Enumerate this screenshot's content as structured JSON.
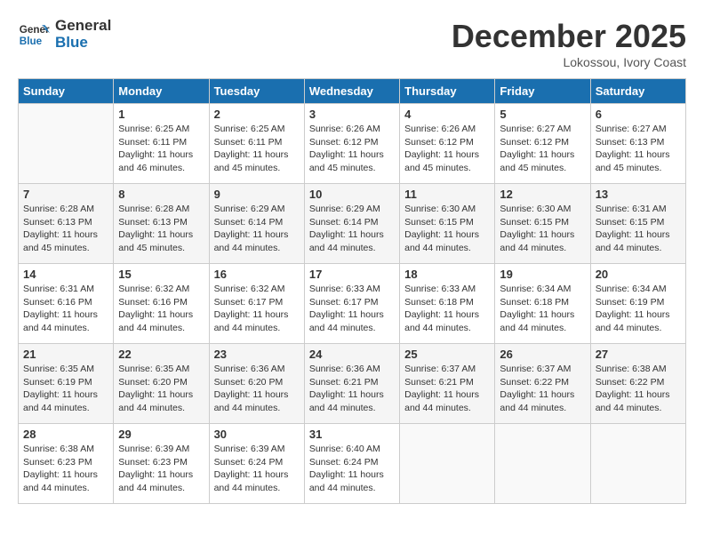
{
  "header": {
    "logo_line1": "General",
    "logo_line2": "Blue",
    "month": "December 2025",
    "location": "Lokossou, Ivory Coast"
  },
  "days_of_week": [
    "Sunday",
    "Monday",
    "Tuesday",
    "Wednesday",
    "Thursday",
    "Friday",
    "Saturday"
  ],
  "weeks": [
    [
      {
        "day": "",
        "info": ""
      },
      {
        "day": "1",
        "info": "Sunrise: 6:25 AM\nSunset: 6:11 PM\nDaylight: 11 hours\nand 46 minutes."
      },
      {
        "day": "2",
        "info": "Sunrise: 6:25 AM\nSunset: 6:11 PM\nDaylight: 11 hours\nand 45 minutes."
      },
      {
        "day": "3",
        "info": "Sunrise: 6:26 AM\nSunset: 6:12 PM\nDaylight: 11 hours\nand 45 minutes."
      },
      {
        "day": "4",
        "info": "Sunrise: 6:26 AM\nSunset: 6:12 PM\nDaylight: 11 hours\nand 45 minutes."
      },
      {
        "day": "5",
        "info": "Sunrise: 6:27 AM\nSunset: 6:12 PM\nDaylight: 11 hours\nand 45 minutes."
      },
      {
        "day": "6",
        "info": "Sunrise: 6:27 AM\nSunset: 6:13 PM\nDaylight: 11 hours\nand 45 minutes."
      }
    ],
    [
      {
        "day": "7",
        "info": "Sunrise: 6:28 AM\nSunset: 6:13 PM\nDaylight: 11 hours\nand 45 minutes."
      },
      {
        "day": "8",
        "info": "Sunrise: 6:28 AM\nSunset: 6:13 PM\nDaylight: 11 hours\nand 45 minutes."
      },
      {
        "day": "9",
        "info": "Sunrise: 6:29 AM\nSunset: 6:14 PM\nDaylight: 11 hours\nand 44 minutes."
      },
      {
        "day": "10",
        "info": "Sunrise: 6:29 AM\nSunset: 6:14 PM\nDaylight: 11 hours\nand 44 minutes."
      },
      {
        "day": "11",
        "info": "Sunrise: 6:30 AM\nSunset: 6:15 PM\nDaylight: 11 hours\nand 44 minutes."
      },
      {
        "day": "12",
        "info": "Sunrise: 6:30 AM\nSunset: 6:15 PM\nDaylight: 11 hours\nand 44 minutes."
      },
      {
        "day": "13",
        "info": "Sunrise: 6:31 AM\nSunset: 6:15 PM\nDaylight: 11 hours\nand 44 minutes."
      }
    ],
    [
      {
        "day": "14",
        "info": "Sunrise: 6:31 AM\nSunset: 6:16 PM\nDaylight: 11 hours\nand 44 minutes."
      },
      {
        "day": "15",
        "info": "Sunrise: 6:32 AM\nSunset: 6:16 PM\nDaylight: 11 hours\nand 44 minutes."
      },
      {
        "day": "16",
        "info": "Sunrise: 6:32 AM\nSunset: 6:17 PM\nDaylight: 11 hours\nand 44 minutes."
      },
      {
        "day": "17",
        "info": "Sunrise: 6:33 AM\nSunset: 6:17 PM\nDaylight: 11 hours\nand 44 minutes."
      },
      {
        "day": "18",
        "info": "Sunrise: 6:33 AM\nSunset: 6:18 PM\nDaylight: 11 hours\nand 44 minutes."
      },
      {
        "day": "19",
        "info": "Sunrise: 6:34 AM\nSunset: 6:18 PM\nDaylight: 11 hours\nand 44 minutes."
      },
      {
        "day": "20",
        "info": "Sunrise: 6:34 AM\nSunset: 6:19 PM\nDaylight: 11 hours\nand 44 minutes."
      }
    ],
    [
      {
        "day": "21",
        "info": "Sunrise: 6:35 AM\nSunset: 6:19 PM\nDaylight: 11 hours\nand 44 minutes."
      },
      {
        "day": "22",
        "info": "Sunrise: 6:35 AM\nSunset: 6:20 PM\nDaylight: 11 hours\nand 44 minutes."
      },
      {
        "day": "23",
        "info": "Sunrise: 6:36 AM\nSunset: 6:20 PM\nDaylight: 11 hours\nand 44 minutes."
      },
      {
        "day": "24",
        "info": "Sunrise: 6:36 AM\nSunset: 6:21 PM\nDaylight: 11 hours\nand 44 minutes."
      },
      {
        "day": "25",
        "info": "Sunrise: 6:37 AM\nSunset: 6:21 PM\nDaylight: 11 hours\nand 44 minutes."
      },
      {
        "day": "26",
        "info": "Sunrise: 6:37 AM\nSunset: 6:22 PM\nDaylight: 11 hours\nand 44 minutes."
      },
      {
        "day": "27",
        "info": "Sunrise: 6:38 AM\nSunset: 6:22 PM\nDaylight: 11 hours\nand 44 minutes."
      }
    ],
    [
      {
        "day": "28",
        "info": "Sunrise: 6:38 AM\nSunset: 6:23 PM\nDaylight: 11 hours\nand 44 minutes."
      },
      {
        "day": "29",
        "info": "Sunrise: 6:39 AM\nSunset: 6:23 PM\nDaylight: 11 hours\nand 44 minutes."
      },
      {
        "day": "30",
        "info": "Sunrise: 6:39 AM\nSunset: 6:24 PM\nDaylight: 11 hours\nand 44 minutes."
      },
      {
        "day": "31",
        "info": "Sunrise: 6:40 AM\nSunset: 6:24 PM\nDaylight: 11 hours\nand 44 minutes."
      },
      {
        "day": "",
        "info": ""
      },
      {
        "day": "",
        "info": ""
      },
      {
        "day": "",
        "info": ""
      }
    ]
  ]
}
